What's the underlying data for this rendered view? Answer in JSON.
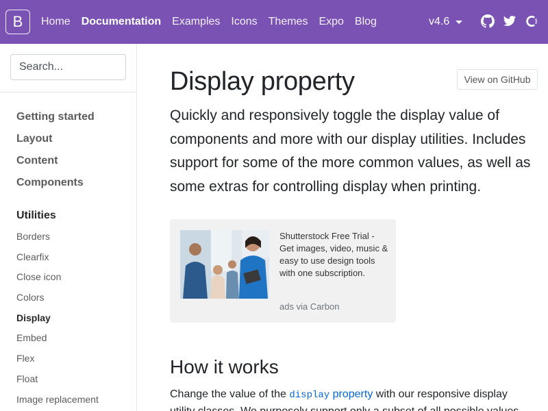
{
  "navbar": {
    "brand": "B",
    "links": [
      "Home",
      "Documentation",
      "Examples",
      "Icons",
      "Themes",
      "Expo",
      "Blog"
    ],
    "active": "Documentation",
    "version": "v4.6",
    "icons": [
      "github-icon",
      "twitter-icon",
      "opencollective-icon"
    ],
    "background": "#7952b3"
  },
  "sidebar": {
    "search_placeholder": "Search...",
    "groups": [
      "Getting started",
      "Layout",
      "Content",
      "Components"
    ],
    "current_group": "Utilities",
    "items": [
      "Borders",
      "Clearfix",
      "Close icon",
      "Colors",
      "Display",
      "Embed",
      "Flex",
      "Float",
      "Image replacement"
    ],
    "active_item": "Display"
  },
  "main": {
    "github_button": "View on GitHub",
    "title": "Display property",
    "lead": "Quickly and responsively toggle the display value of components and more with our display utilities. Includes support for some of the more common values, as well as some extras for controlling display when printing.",
    "ad": {
      "text": "Shutterstock Free Trial - Get images, video, music & easy to use design tools with one subscription.",
      "powered_by": "ads via Carbon"
    },
    "section_title": "How it works",
    "paragraph": {
      "before": "Change the value of the ",
      "code": "display",
      "link": " property",
      "after": " with our responsive display",
      "line2": "utility classes. We purposely support only a subset of all possible values"
    },
    "link_color": "#0366d6"
  }
}
